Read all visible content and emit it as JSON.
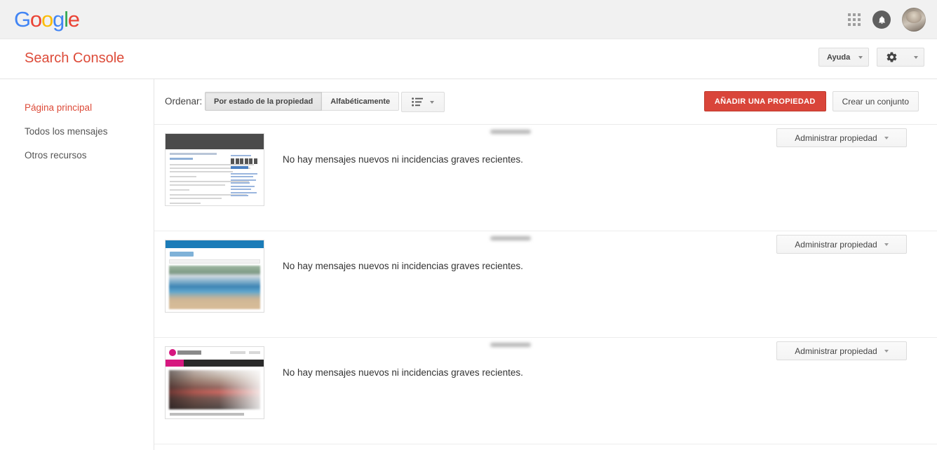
{
  "google_bar": {
    "logo_letters": [
      {
        "char": "G",
        "color": "#4285f4"
      },
      {
        "char": "o",
        "color": "#ea4335"
      },
      {
        "char": "o",
        "color": "#fbbc05"
      },
      {
        "char": "g",
        "color": "#4285f4"
      },
      {
        "char": "l",
        "color": "#34a853"
      },
      {
        "char": "e",
        "color": "#ea4335"
      }
    ],
    "apps_icon": "apps-grid-icon",
    "notifications_icon": "notification-bell-icon",
    "avatar": "user-avatar"
  },
  "header": {
    "product_title": "Search Console",
    "help_label": "Ayuda",
    "settings_icon": "gear-icon",
    "dropdown_icon": "chevron-down-icon"
  },
  "sidebar": {
    "items": [
      {
        "label": "Página principal",
        "active": true
      },
      {
        "label": "Todos los mensajes",
        "active": false
      },
      {
        "label": "Otros recursos",
        "active": false
      }
    ]
  },
  "toolbar": {
    "sort_label": "Ordenar:",
    "sort_options": [
      {
        "label": "Por estado de la propiedad",
        "selected": true
      },
      {
        "label": "Alfabéticamente",
        "selected": false
      }
    ],
    "view_icon": "list-view-icon",
    "add_property_label": "AÑADIR UNA PROPIEDAD",
    "create_set_label": "Crear un conjunto"
  },
  "properties": [
    {
      "thumbnail": "site-thumbnail-dark-header",
      "url_redacted": true,
      "status": "No hay mensajes nuevos ni incidencias graves recientes.",
      "manage_label": "Administrar propiedad"
    },
    {
      "thumbnail": "site-thumbnail-blue-header-pool",
      "url_redacted": true,
      "status": "No hay mensajes nuevos ni incidencias graves recientes.",
      "manage_label": "Administrar propiedad"
    },
    {
      "thumbnail": "site-thumbnail-pink-logo-dark-nav",
      "url_redacted": true,
      "status": "No hay mensajes nuevos ni incidencias graves recientes.",
      "manage_label": "Administrar propiedad"
    }
  ],
  "colors": {
    "brand_red": "#dd4b39",
    "primary_button": "#d9453a",
    "google_bar_bg": "#f1f1f1",
    "divider": "#e5e5e5"
  }
}
